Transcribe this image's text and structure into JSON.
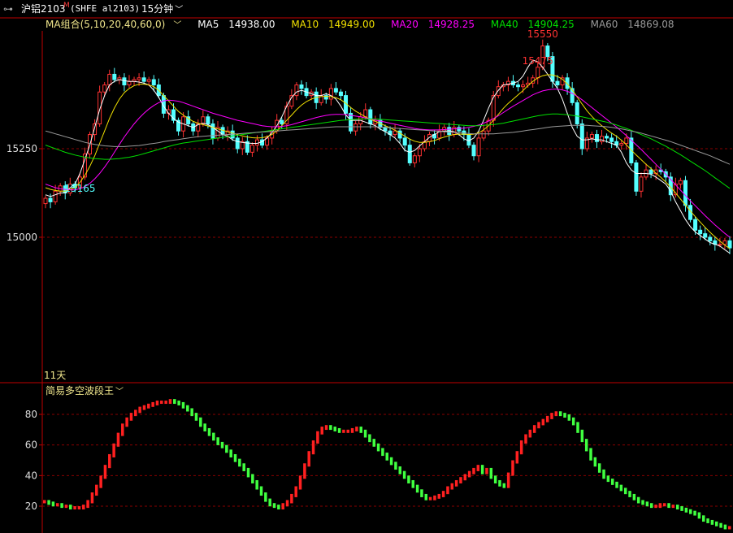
{
  "header": {
    "window_icon": "link-icon",
    "symbol": "沪铝2103",
    "symbol_mark": "M",
    "code": "(SHFE al2103)",
    "period": "15分钟",
    "period_caret": "chevron-down-icon"
  },
  "ma_legend": {
    "label": "MA组合(5,10,20,40,60,0)",
    "items": [
      {
        "name": "MA5",
        "value": "14938.00",
        "color": "#ffffff"
      },
      {
        "name": "MA10",
        "value": "14949.00",
        "color": "#f0e000"
      },
      {
        "name": "MA20",
        "value": "14928.25",
        "color": "#ff00ff"
      },
      {
        "name": "MA40",
        "value": "14904.25",
        "color": "#00e000"
      },
      {
        "name": "MA60",
        "value": "14869.08",
        "color": "#999999"
      }
    ]
  },
  "indicator": {
    "label": "简易多空波段王",
    "days_label": "11天"
  },
  "colors": {
    "up": "#ff3232",
    "down": "#54ffff",
    "grid": "#8a0000",
    "axis": "#c00000"
  },
  "chart_data": [
    {
      "type": "candlestick",
      "title": "沪铝2103 15分钟",
      "yticks": [
        15000,
        15250
      ],
      "ylim": [
        14800,
        15600
      ],
      "annotations": [
        {
          "label": "15475",
          "value": 15475,
          "color": "#ff3232"
        },
        {
          "label": "15550",
          "value": 15550,
          "color": "#ff3232"
        },
        {
          "label": "15165",
          "value": 15165,
          "color": "#54ffff"
        }
      ],
      "closes": [
        15110,
        15100,
        15130,
        15145,
        15125,
        15150,
        15140,
        15170,
        15235,
        15290,
        15320,
        15410,
        15430,
        15460,
        15445,
        15450,
        15430,
        15440,
        15445,
        15450,
        15440,
        15445,
        15430,
        15400,
        15350,
        15360,
        15330,
        15300,
        15340,
        15320,
        15300,
        15320,
        15340,
        15320,
        15280,
        15310,
        15290,
        15300,
        15280,
        15250,
        15270,
        15240,
        15260,
        15275,
        15260,
        15280,
        15300,
        15330,
        15320,
        15370,
        15400,
        15430,
        15420,
        15400,
        15410,
        15380,
        15400,
        15390,
        15420,
        15410,
        15400,
        15350,
        15300,
        15320,
        15340,
        15360,
        15320,
        15330,
        15310,
        15300,
        15290,
        15300,
        15280,
        15260,
        15210,
        15230,
        15250,
        15270,
        15290,
        15280,
        15300,
        15310,
        15290,
        15310,
        15300,
        15290,
        15260,
        15230,
        15280,
        15300,
        15330,
        15400,
        15425,
        15430,
        15440,
        15430,
        15425,
        15430,
        15435,
        15450,
        15480,
        15540,
        15510,
        15440,
        15430,
        15450,
        15420,
        15380,
        15320,
        15250,
        15280,
        15290,
        15270,
        15285,
        15280,
        15270,
        15260,
        15265,
        15280,
        15210,
        15130,
        15170,
        15190,
        15180,
        15190,
        15185,
        15170,
        15120,
        15150,
        15160,
        15090,
        15050,
        15020,
        15010,
        15000,
        14990,
        14980,
        14980,
        14990,
        14970
      ],
      "ma": {
        "MA5": [
          15120,
          15115,
          15120,
          15125,
          15125,
          15140,
          15150,
          15180,
          15220,
          15260,
          15310,
          15360,
          15400,
          15430,
          15440,
          15445,
          15442,
          15440,
          15440,
          15438,
          15435,
          15430,
          15415,
          15395,
          15370,
          15350,
          15335,
          15325,
          15320,
          15315,
          15310,
          15318,
          15322,
          15318,
          15310,
          15300,
          15290,
          15285,
          15275,
          15270,
          15268,
          15266,
          15265,
          15265,
          15270,
          15280,
          15295,
          15315,
          15340,
          15370,
          15395,
          15410,
          15415,
          15410,
          15405,
          15400,
          15400,
          15405,
          15400,
          15390,
          15370,
          15345,
          15330,
          15330,
          15330,
          15325,
          15320,
          15315,
          15305,
          15298,
          15290,
          15280,
          15265,
          15245,
          15240,
          15245,
          15258,
          15270,
          15282,
          15290,
          15298,
          15300,
          15300,
          15298,
          15290,
          15278,
          15272,
          15280,
          15300,
          15330,
          15365,
          15395,
          15415,
          15430,
          15432,
          15435,
          15440,
          15455,
          15480,
          15500,
          15495,
          15480,
          15460,
          15440,
          15420,
          15390,
          15350,
          15310,
          15285,
          15275,
          15275,
          15278,
          15275,
          15275,
          15270,
          15265,
          15260,
          15240,
          15210,
          15190,
          15180,
          15180,
          15180,
          15178,
          15170,
          15160,
          15150,
          15130,
          15100,
          15075,
          15050,
          15030,
          15015,
          15005,
          14995,
          14985,
          14980,
          14975,
          14965,
          14955
        ],
        "MA10": [
          15140,
          15135,
          15132,
          15130,
          15130,
          15135,
          15140,
          15155,
          15175,
          15200,
          15230,
          15265,
          15300,
          15335,
          15365,
          15390,
          15408,
          15420,
          15428,
          15432,
          15432,
          15430,
          15425,
          15415,
          15400,
          15385,
          15370,
          15355,
          15345,
          15335,
          15327,
          15322,
          15318,
          15314,
          15310,
          15306,
          15302,
          15298,
          15294,
          15290,
          15286,
          15283,
          15281,
          15280,
          15281,
          15284,
          15290,
          15300,
          15315,
          15330,
          15345,
          15360,
          15373,
          15383,
          15390,
          15395,
          15397,
          15398,
          15397,
          15394,
          15388,
          15378,
          15366,
          15356,
          15348,
          15340,
          15333,
          15327,
          15321,
          15315,
          15309,
          15302,
          15294,
          15285,
          15277,
          15271,
          15268,
          15268,
          15270,
          15273,
          15278,
          15283,
          15287,
          15290,
          15291,
          15291,
          15290,
          15291,
          15295,
          15303,
          15315,
          15330,
          15347,
          15364,
          15378,
          15390,
          15402,
          15414,
          15428,
          15440,
          15450,
          15456,
          15459,
          15458,
          15454,
          15446,
          15433,
          15416,
          15396,
          15376,
          15357,
          15341,
          15327,
          15315,
          15304,
          15294,
          15285,
          15274,
          15261,
          15246,
          15232,
          15219,
          15206,
          15194,
          15181,
          15169,
          15156,
          15141,
          15125,
          15108,
          15091,
          15074,
          15058,
          15043,
          15028,
          15014,
          15001,
          14989,
          14978,
          14968
        ],
        "MA20": [
          15150,
          15145,
          15140,
          15137,
          15135,
          15134,
          15134,
          15137,
          15143,
          15152,
          15165,
          15180,
          15198,
          15218,
          15240,
          15262,
          15283,
          15302,
          15320,
          15336,
          15350,
          15362,
          15372,
          15380,
          15385,
          15387,
          15386,
          15384,
          15380,
          15375,
          15370,
          15365,
          15360,
          15355,
          15350,
          15346,
          15342,
          15338,
          15334,
          15330,
          15327,
          15324,
          15321,
          15318,
          15315,
          15313,
          15312,
          15312,
          15313,
          15315,
          15318,
          15322,
          15326,
          15330,
          15334,
          15338,
          15341,
          15344,
          15346,
          15347,
          15347,
          15346,
          15344,
          15342,
          15340,
          15337,
          15334,
          15331,
          15328,
          15325,
          15322,
          15319,
          15316,
          15313,
          15310,
          15307,
          15305,
          15304,
          15303,
          15303,
          15303,
          15304,
          15305,
          15306,
          15307,
          15308,
          15310,
          15313,
          15317,
          15322,
          15328,
          15335,
          15343,
          15352,
          15361,
          15370,
          15378,
          15386,
          15394,
          15402,
          15408,
          15413,
          15416,
          15418,
          15418,
          15416,
          15412,
          15406,
          15398,
          15388,
          15377,
          15366,
          15355,
          15344,
          15333,
          15322,
          15311,
          15299,
          15287,
          15274,
          15261,
          15248,
          15234,
          15220,
          15206,
          15192,
          15178,
          15163,
          15148,
          15133,
          15118,
          15103,
          15089,
          15075,
          15061,
          15048,
          15035,
          15023,
          15011,
          15000
        ],
        "MA40": [
          15260,
          15255,
          15250,
          15245,
          15240,
          15236,
          15232,
          15229,
          15226,
          15224,
          15222,
          15221,
          15220,
          15220,
          15221,
          15222,
          15224,
          15226,
          15229,
          15232,
          15236,
          15240,
          15244,
          15248,
          15252,
          15256,
          15260,
          15263,
          15266,
          15268,
          15270,
          15272,
          15274,
          15276,
          15278,
          15280,
          15282,
          15284,
          15286,
          15288,
          15290,
          15292,
          15294,
          15296,
          15298,
          15300,
          15302,
          15304,
          15306,
          15308,
          15310,
          15312,
          15314,
          15316,
          15318,
          15320,
          15322,
          15324,
          15326,
          15328,
          15330,
          15331,
          15332,
          15333,
          15334,
          15334,
          15334,
          15334,
          15333,
          15332,
          15331,
          15330,
          15329,
          15328,
          15327,
          15326,
          15325,
          15324,
          15323,
          15322,
          15321,
          15320,
          15319,
          15318,
          15317,
          15316,
          15315,
          15315,
          15315,
          15316,
          15317,
          15318,
          15320,
          15322,
          15325,
          15328,
          15331,
          15334,
          15337,
          15340,
          15343,
          15345,
          15347,
          15348,
          15348,
          15347,
          15346,
          15344,
          15342,
          15340,
          15337,
          15334,
          15331,
          15328,
          15325,
          15321,
          15317,
          15312,
          15307,
          15302,
          15296,
          15290,
          15284,
          15278,
          15271,
          15264,
          15257,
          15249,
          15241,
          15233,
          15224,
          15215,
          15206,
          15197,
          15188,
          15178,
          15168,
          15158,
          15148,
          15138
        ],
        "MA60": [
          15300,
          15296,
          15292,
          15288,
          15284,
          15280,
          15276,
          15272,
          15268,
          15265,
          15262,
          15260,
          15258,
          15257,
          15256,
          15256,
          15256,
          15257,
          15258,
          15259,
          15261,
          15263,
          15265,
          15267,
          15270,
          15272,
          15274,
          15276,
          15278,
          15280,
          15282,
          15284,
          15285,
          15286,
          15287,
          15288,
          15289,
          15290,
          15291,
          15292,
          15293,
          15294,
          15295,
          15296,
          15297,
          15298,
          15299,
          15300,
          15301,
          15302,
          15303,
          15304,
          15305,
          15306,
          15307,
          15308,
          15309,
          15310,
          15311,
          15312,
          15312,
          15312,
          15312,
          15312,
          15312,
          15312,
          15312,
          15312,
          15311,
          15310,
          15309,
          15308,
          15307,
          15306,
          15305,
          15304,
          15303,
          15302,
          15301,
          15300,
          15299,
          15298,
          15297,
          15296,
          15295,
          15294,
          15293,
          15292,
          15292,
          15292,
          15292,
          15292,
          15293,
          15294,
          15295,
          15296,
          15298,
          15300,
          15302,
          15304,
          15306,
          15308,
          15310,
          15312,
          15313,
          15314,
          15315,
          15316,
          15316,
          15316,
          15316,
          15315,
          15314,
          15313,
          15312,
          15310,
          15308,
          15306,
          15303,
          15300,
          15297,
          15294,
          15290,
          15286,
          15282,
          15278,
          15274,
          15270,
          15265,
          15260,
          15255,
          15250,
          15245,
          15240,
          15235,
          15230,
          15224,
          15218,
          15212,
          15206
        ]
      }
    },
    {
      "type": "bar",
      "title": "简易多空波段王",
      "yticks": [
        20,
        40,
        60,
        80
      ],
      "ylim": [
        2,
        100
      ],
      "values": [
        24,
        23,
        22,
        22,
        21,
        21,
        20,
        20,
        20,
        21,
        24,
        29,
        34,
        40,
        47,
        54,
        61,
        68,
        74,
        78,
        81,
        83,
        85,
        86,
        87,
        88,
        89,
        89,
        89,
        90,
        89,
        88,
        86,
        84,
        81,
        78,
        74,
        71,
        68,
        65,
        62,
        60,
        57,
        54,
        51,
        48,
        45,
        41,
        37,
        33,
        29,
        25,
        22,
        21,
        20,
        22,
        24,
        28,
        33,
        40,
        48,
        56,
        63,
        69,
        72,
        73,
        72,
        71,
        70,
        70,
        70,
        71,
        72,
        70,
        67,
        64,
        61,
        58,
        55,
        52,
        49,
        46,
        43,
        40,
        37,
        34,
        31,
        28,
        26,
        26,
        27,
        28,
        30,
        33,
        35,
        37,
        39,
        41,
        43,
        45,
        47,
        43,
        45,
        40,
        37,
        35,
        34,
        42,
        50,
        56,
        63,
        67,
        70,
        73,
        75,
        77,
        79,
        81,
        82,
        81,
        80,
        78,
        75,
        70,
        64,
        58,
        52,
        48,
        44,
        40,
        38,
        36,
        34,
        32,
        30,
        28,
        26,
        24,
        23,
        22,
        21,
        21,
        22,
        22,
        21,
        21,
        20,
        19,
        18,
        17,
        16,
        14,
        12,
        11,
        10,
        9,
        8,
        7,
        7
      ],
      "colors_by_trend": true
    }
  ]
}
